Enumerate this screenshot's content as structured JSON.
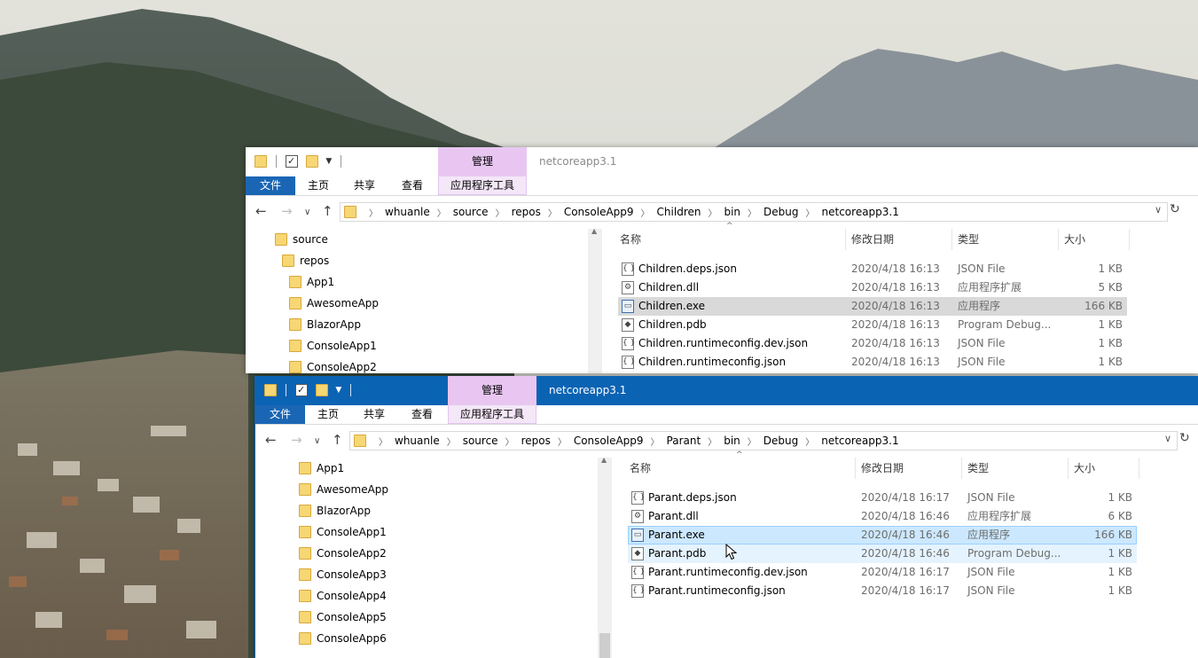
{
  "back_window": {
    "title": "netcoreapp3.1",
    "context_group_label": "管理",
    "ribbon_tabs": [
      "文件",
      "主页",
      "共享",
      "查看",
      "应用程序工具"
    ],
    "breadcrumb": [
      "whuanle",
      "source",
      "repos",
      "ConsoleApp9",
      "Children",
      "bin",
      "Debug",
      "netcoreapp3.1"
    ],
    "nav_items": [
      "source",
      "repos",
      "App1",
      "AwesomeApp",
      "BlazorApp",
      "ConsoleApp1",
      "ConsoleApp2"
    ],
    "columns": {
      "name": "名称",
      "modified": "修改日期",
      "type": "类型",
      "size": "大小"
    },
    "files": [
      {
        "name": "Children.deps.json",
        "modified": "2020/4/18 16:13",
        "type": "JSON File",
        "size": "1 KB",
        "icon": "json-file-icon"
      },
      {
        "name": "Children.dll",
        "modified": "2020/4/18 16:13",
        "type": "应用程序扩展",
        "size": "5 KB",
        "icon": "dll-file-icon"
      },
      {
        "name": "Children.exe",
        "modified": "2020/4/18 16:13",
        "type": "应用程序",
        "size": "166 KB",
        "icon": "exe-file-icon"
      },
      {
        "name": "Children.pdb",
        "modified": "2020/4/18 16:13",
        "type": "Program Debug...",
        "size": "1 KB",
        "icon": "pdb-file-icon"
      },
      {
        "name": "Children.runtimeconfig.dev.json",
        "modified": "2020/4/18 16:13",
        "type": "JSON File",
        "size": "1 KB",
        "icon": "json-file-icon"
      },
      {
        "name": "Children.runtimeconfig.json",
        "modified": "2020/4/18 16:13",
        "type": "JSON File",
        "size": "1 KB",
        "icon": "json-file-icon"
      }
    ]
  },
  "front_window": {
    "title": "netcoreapp3.1",
    "context_group_label": "管理",
    "ribbon_tabs": [
      "文件",
      "主页",
      "共享",
      "查看",
      "应用程序工具"
    ],
    "breadcrumb": [
      "whuanle",
      "source",
      "repos",
      "ConsoleApp9",
      "Parant",
      "bin",
      "Debug",
      "netcoreapp3.1"
    ],
    "nav_items": [
      "App1",
      "AwesomeApp",
      "BlazorApp",
      "ConsoleApp1",
      "ConsoleApp2",
      "ConsoleApp3",
      "ConsoleApp4",
      "ConsoleApp5",
      "ConsoleApp6"
    ],
    "columns": {
      "name": "名称",
      "modified": "修改日期",
      "type": "类型",
      "size": "大小"
    },
    "files": [
      {
        "name": "Parant.deps.json",
        "modified": "2020/4/18 16:17",
        "type": "JSON File",
        "size": "1 KB",
        "icon": "json-file-icon"
      },
      {
        "name": "Parant.dll",
        "modified": "2020/4/18 16:46",
        "type": "应用程序扩展",
        "size": "6 KB",
        "icon": "dll-file-icon"
      },
      {
        "name": "Parant.exe",
        "modified": "2020/4/18 16:46",
        "type": "应用程序",
        "size": "166 KB",
        "icon": "exe-file-icon"
      },
      {
        "name": "Parant.pdb",
        "modified": "2020/4/18 16:46",
        "type": "Program Debug...",
        "size": "1 KB",
        "icon": "pdb-file-icon"
      },
      {
        "name": "Parant.runtimeconfig.dev.json",
        "modified": "2020/4/18 16:17",
        "type": "JSON File",
        "size": "1 KB",
        "icon": "json-file-icon"
      },
      {
        "name": "Parant.runtimeconfig.json",
        "modified": "2020/4/18 16:17",
        "type": "JSON File",
        "size": "1 KB",
        "icon": "json-file-icon"
      }
    ]
  },
  "colors": {
    "accent_blue": "#0b63b4",
    "file_tab_blue": "#1a66b5",
    "context_tab_purple": "#e8c6f1",
    "folder_yellow": "#f7d674",
    "selection_gray": "#d9d9d9",
    "selection_blue": "#cce8ff"
  }
}
